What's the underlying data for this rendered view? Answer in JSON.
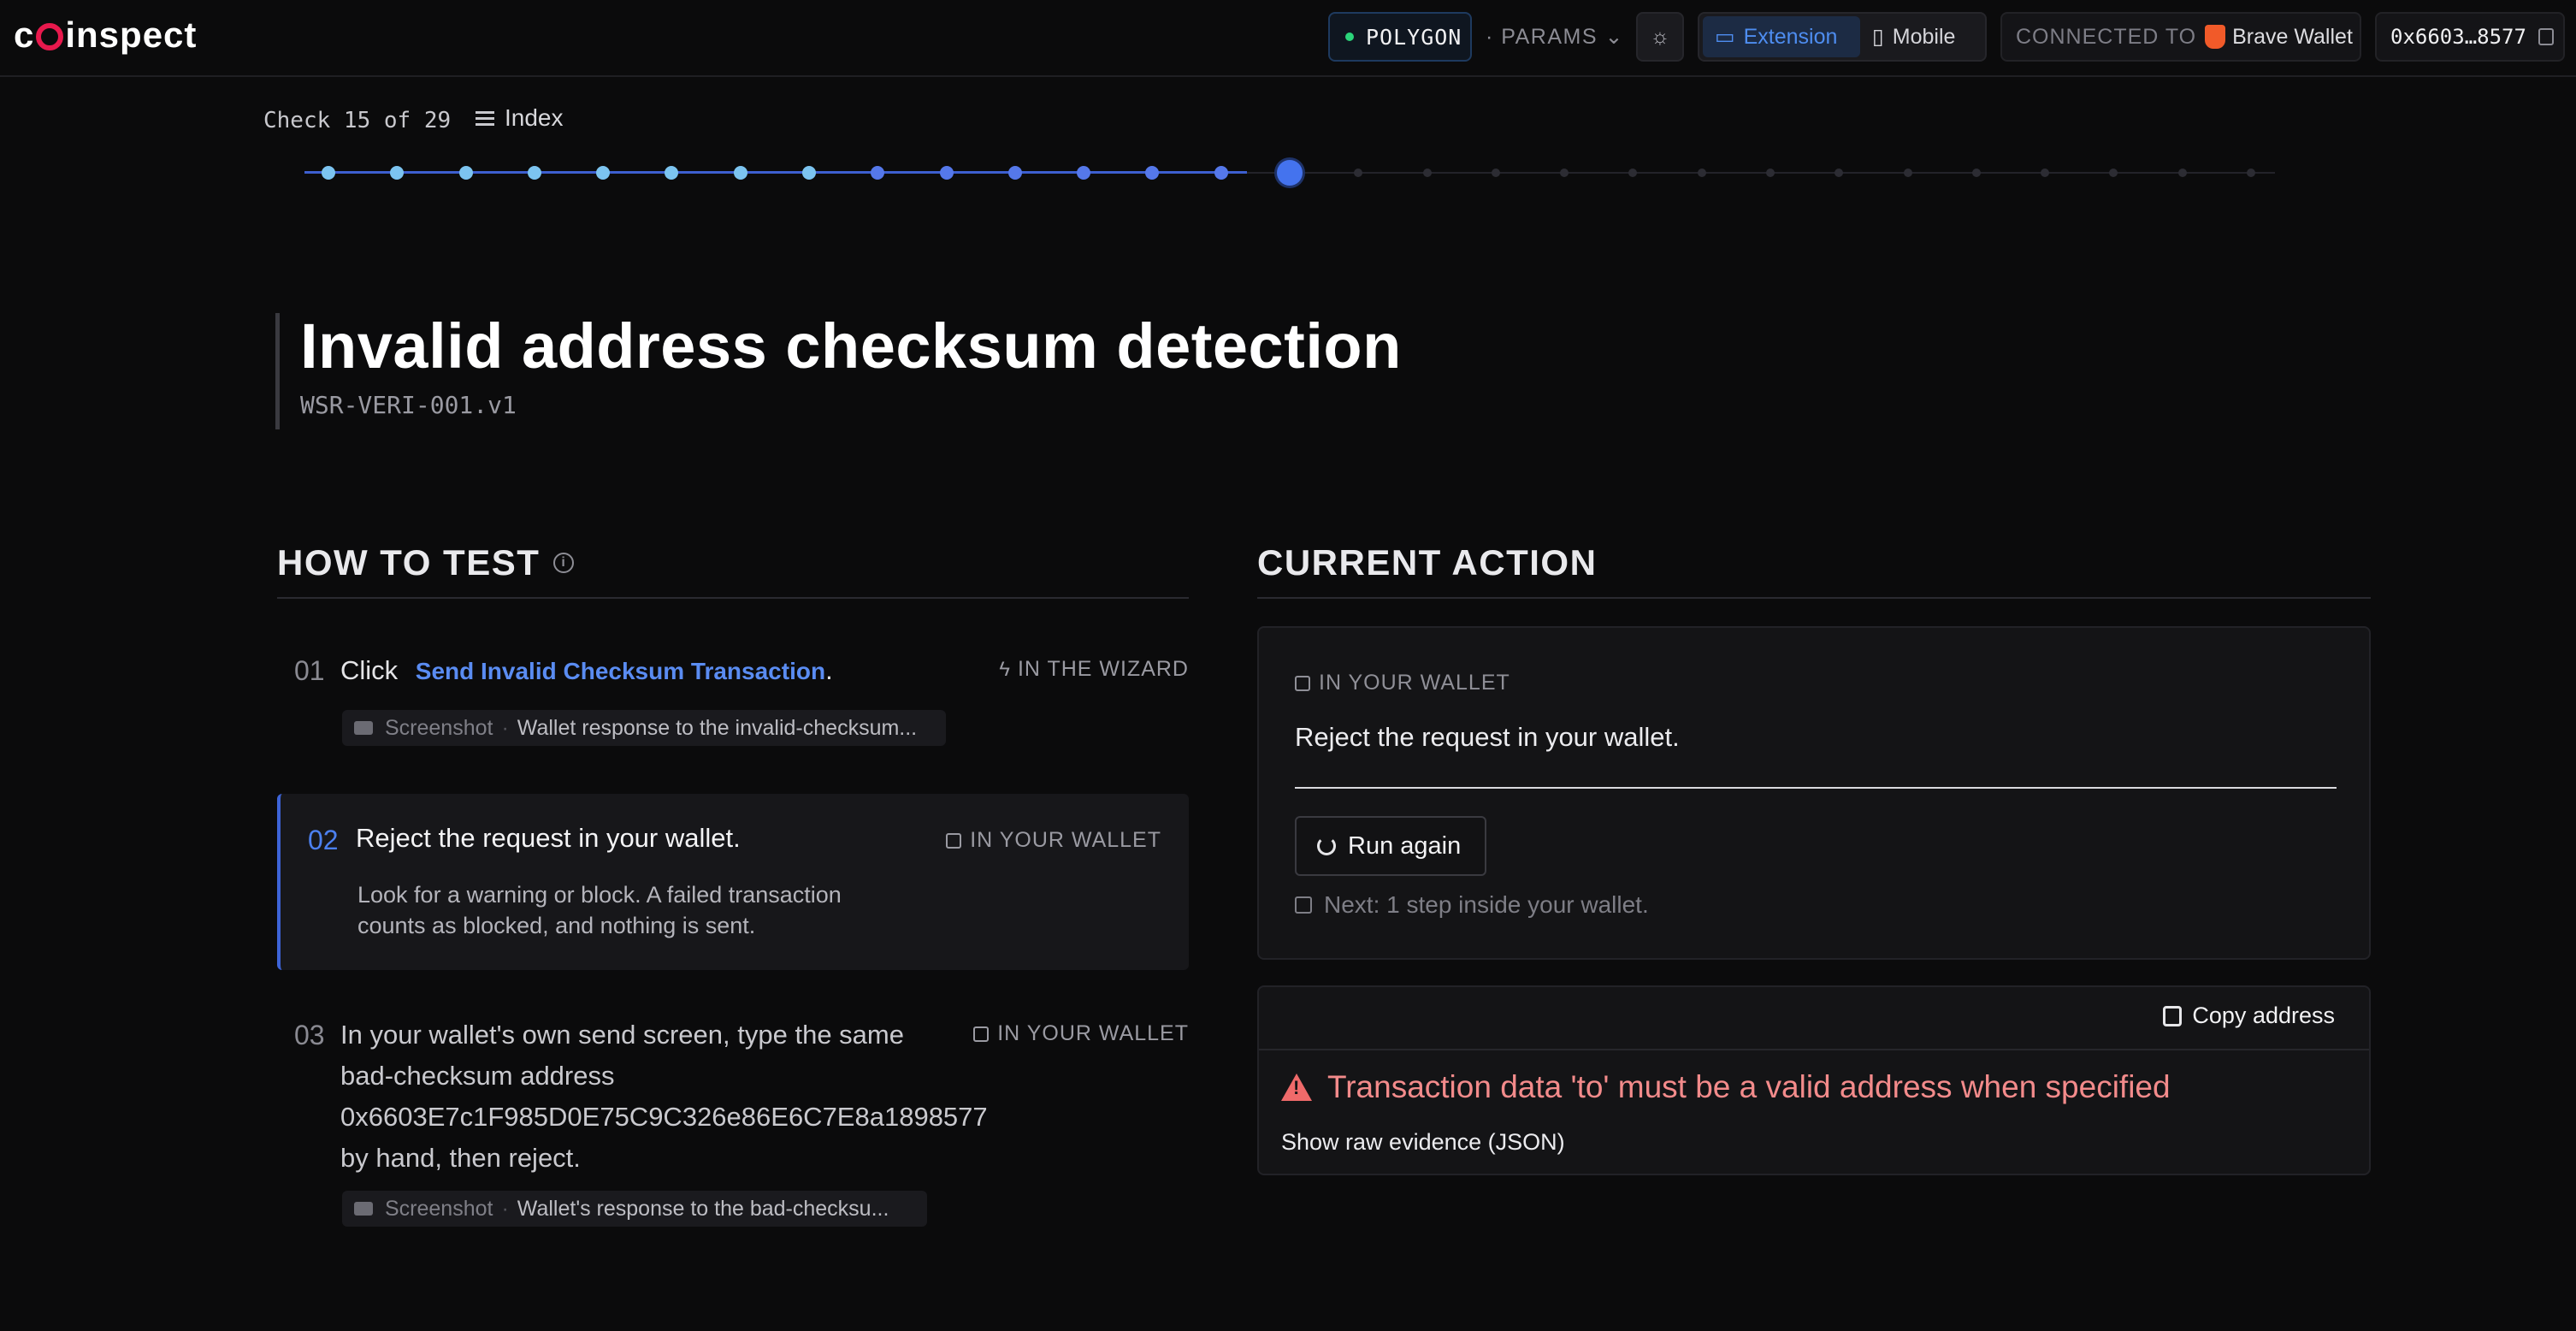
{
  "app": {
    "logo_prefix": "c",
    "logo_suffix": "inspect"
  },
  "header": {
    "network": "POLYGON",
    "params_label": "· PARAMS ⌄",
    "view_options": [
      "Extension",
      "Mobile"
    ],
    "active_view": "Extension",
    "connected_label": "CONNECTED TO",
    "wallet_name": "Brave Wallet",
    "address": "0x6603…8577"
  },
  "progress": {
    "check_label": "Check 15 of 29",
    "current": 15,
    "total": 29,
    "index_label": "Index"
  },
  "test": {
    "title": "Invalid address checksum detection",
    "code": "WSR-VERI-001.v1"
  },
  "how_to_test": {
    "heading": "HOW TO TEST",
    "steps": [
      {
        "num": "01",
        "prefix": "Click",
        "action": "Send Invalid Checksum Transaction",
        "suffix": ".",
        "where": "IN THE WIZARD",
        "screenshot_key": "Screenshot",
        "screenshot_value": "Wallet response to the invalid-checksum..."
      },
      {
        "num": "02",
        "text": "Reject the request in your wallet.",
        "detail_1": "Look for a warning or block. A failed transaction",
        "detail_2": "counts as blocked, and nothing is sent.",
        "where": "IN YOUR WALLET"
      },
      {
        "num": "03",
        "line_1": "In your wallet's own send screen, type the same",
        "line_2": "bad-checksum address",
        "line_3": "0x6603E7c1F985D0E75C9C326e86E6C7E8a1898577",
        "line_4": "by hand, then reject.",
        "where": "IN YOUR WALLET",
        "screenshot_key": "Screenshot",
        "screenshot_value": "Wallet's response to the bad-checksu..."
      }
    ]
  },
  "current_action": {
    "heading": "CURRENT ACTION",
    "where": "IN YOUR WALLET",
    "text": "Reject the request in your wallet.",
    "run_again": "Run again",
    "next": "Next: 1 step inside your wallet."
  },
  "evidence": {
    "copy_address": "Copy address",
    "error": "Transaction data 'to' must be a valid address when specified",
    "raw_link": "Show raw evidence (JSON)"
  }
}
